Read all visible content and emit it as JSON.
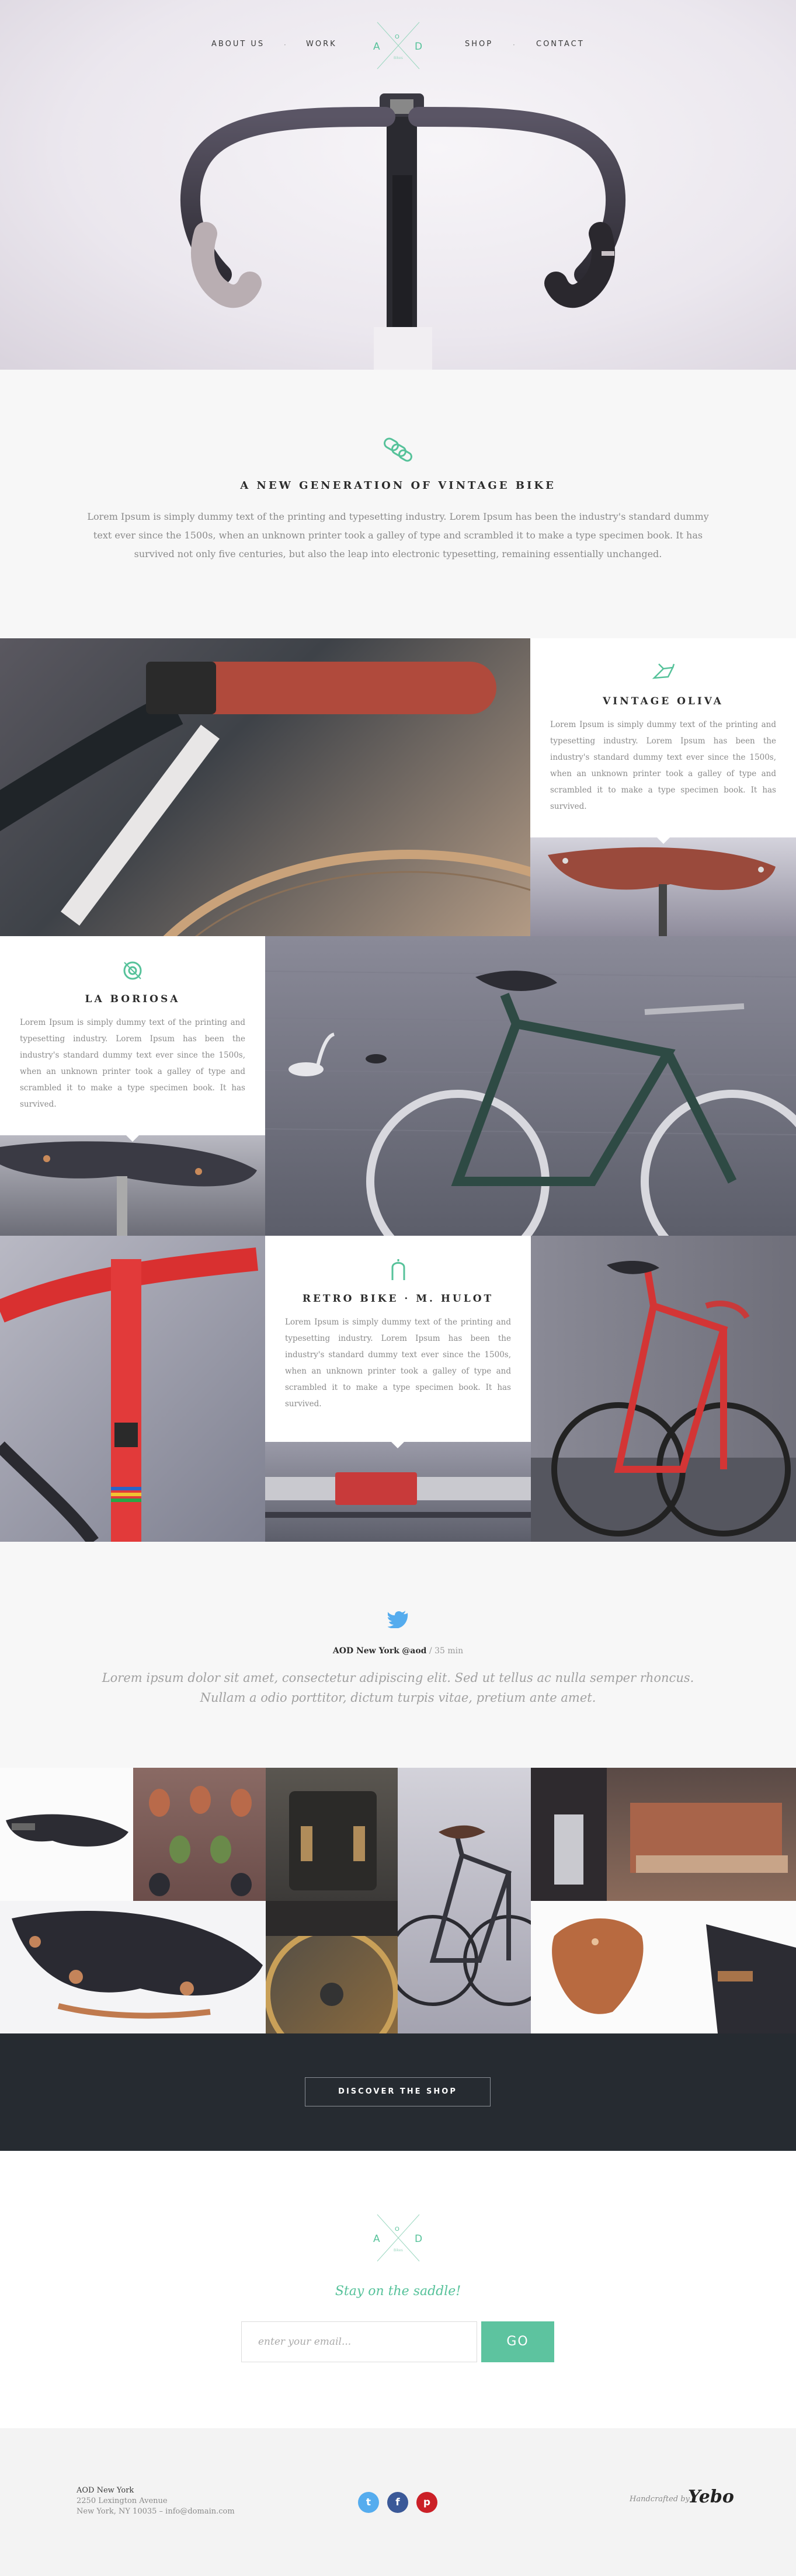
{
  "nav": {
    "items": [
      {
        "label": "ABOUT US"
      },
      {
        "label": "WORK"
      },
      {
        "label": "SHOP"
      },
      {
        "label": "CONTACT"
      }
    ],
    "separator": "·"
  },
  "logo": {
    "a": "A",
    "o": "O",
    "d": "D",
    "sub": "Bikes"
  },
  "intro": {
    "title": "A NEW GENERATION OF VINTAGE BIKE",
    "body": "Lorem Ipsum is simply dummy text of the printing and typesetting industry. Lorem Ipsum has been the industry's standard dummy text ever since the 1500s, when an unknown printer took a galley of type and scrambled it to make a type specimen book. It has survived not only five centuries, but also the leap into electronic typesetting, remaining essentially unchanged."
  },
  "cards": [
    {
      "title": "VINTAGE OLIVA",
      "body": "Lorem Ipsum is simply dummy text of the printing and typesetting industry. Lorem Ipsum has been the industry's standard dummy text ever since the 1500s, when an unknown printer took a galley of type and scrambled it to make a type specimen book. It has survived."
    },
    {
      "title": "LA BORIOSA",
      "body": "Lorem Ipsum is simply dummy text of the printing and typesetting industry. Lorem Ipsum has been the industry's standard dummy text ever since the 1500s, when an unknown printer took a galley of type and scrambled it to make a type specimen book. It has survived."
    },
    {
      "title": "RETRO BIKE · M. HULOT",
      "body": "Lorem Ipsum is simply dummy text of the printing and typesetting industry. Lorem Ipsum has been the industry's standard dummy text ever since the 1500s, when an unknown printer took a galley of type and scrambled it to make a type specimen book. It has survived."
    }
  ],
  "tweet": {
    "name": "AOD New York",
    "handle": "@aod",
    "time": "/ 35 min",
    "text": "Lorem ipsum dolor sit amet, consectetur adipiscing elit. Sed ut tellus ac nulla semper rhoncus. Nullam a odio porttitor, dictum turpis vitae, pretium ante amet."
  },
  "shop": {
    "button": "DISCOVER THE SHOP"
  },
  "newsletter": {
    "tagline": "Stay on the saddle!",
    "placeholder": "enter your email...",
    "button": "GO"
  },
  "footer": {
    "name": "AOD New York",
    "street": "2250 Lexington Avenue",
    "city_email": "New York, NY 10035 – info@domain.com",
    "social": [
      {
        "icon": "twitter-icon",
        "glyph": "t",
        "color": "#55acee"
      },
      {
        "icon": "facebook-icon",
        "glyph": "f",
        "color": "#3b5998"
      },
      {
        "icon": "pinterest-icon",
        "glyph": "p",
        "color": "#cb2027"
      }
    ],
    "handcrafted": "Handcrafted by",
    "brand": "Yebo"
  },
  "colors": {
    "accent": "#5dc39f",
    "dark": "#262b31",
    "twitter": "#55acee"
  }
}
